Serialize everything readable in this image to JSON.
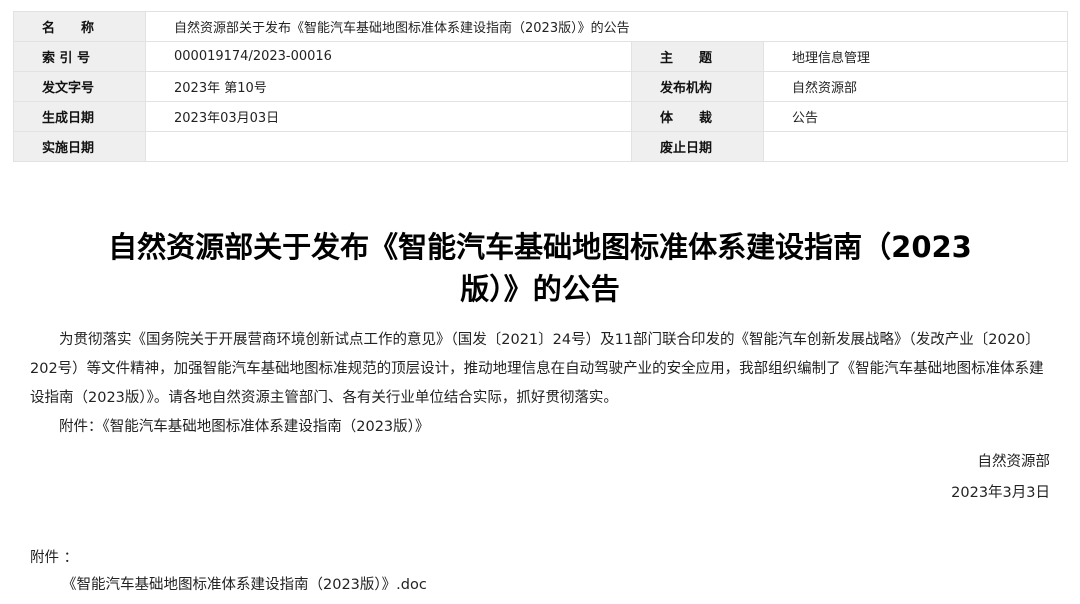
{
  "meta": {
    "name_label": "名　　称",
    "name_value": "自然资源部关于发布《智能汽车基础地图标准体系建设指南（2023版）》的公告",
    "index_label": "索 引 号",
    "index_value": "000019174/2023-00016",
    "subject_label": "主　　题",
    "subject_value": "地理信息管理",
    "doc_no_label": "发文字号",
    "doc_no_value": "2023年 第10号",
    "issuer_label": "发布机构",
    "issuer_value": "自然资源部",
    "date_label": "生成日期",
    "date_value": "2023年03月03日",
    "genre_label": "体　　裁",
    "genre_value": "公告",
    "effective_label": "实施日期",
    "effective_value": "",
    "abolish_label": "废止日期",
    "abolish_value": ""
  },
  "article": {
    "title": "自然资源部关于发布《智能汽车基础地图标准体系建设指南（2023版）》的公告",
    "paragraph1": "为贯彻落实《国务院关于开展营商环境创新试点工作的意见》（国发〔2021〕24号）及11部门联合印发的《智能汽车创新发展战略》（发改产业〔2020〕202号）等文件精神，加强智能汽车基础地图标准规范的顶层设计，推动地理信息在自动驾驶产业的安全应用，我部组织编制了《智能汽车基础地图标准体系建设指南（2023版）》。请各地自然资源主管部门、各有关行业单位结合实际，抓好贯彻落实。",
    "paragraph2": "附件：《智能汽车基础地图标准体系建设指南（2023版）》",
    "signature_org": "自然资源部",
    "signature_date": "2023年3月3日"
  },
  "attachments": {
    "label": "附件 ：",
    "file": "《智能汽车基础地图标准体系建设指南（2023版）》.doc"
  }
}
